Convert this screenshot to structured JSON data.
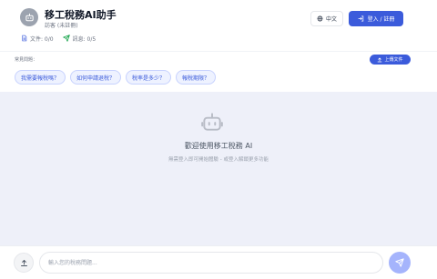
{
  "header": {
    "title": "移工稅務AI助手",
    "guest_label": "訪客 (未註冊)",
    "usage": {
      "files_label": "文件: 0/0",
      "messages_label": "訊息: 0/5"
    },
    "language_button": "中文",
    "login_button": "登入 / 註冊",
    "accent_color": "#3b5bdb"
  },
  "faq": {
    "label": "常見問題：",
    "upload_button": "上傳文件",
    "chips": [
      "我需要報稅嗎？",
      "如何申請退稅？",
      "稅率是多少？",
      "報稅期限？"
    ]
  },
  "welcome": {
    "icon": "robot-icon",
    "title": "歡迎使用移工稅務 AI",
    "subtitle": "無需登入即可開始體驗 - 或登入解鎖更多功能"
  },
  "composer": {
    "placeholder": "輸入您的稅務問題...",
    "attach_icon": "upload-icon",
    "send_icon": "send-icon"
  }
}
